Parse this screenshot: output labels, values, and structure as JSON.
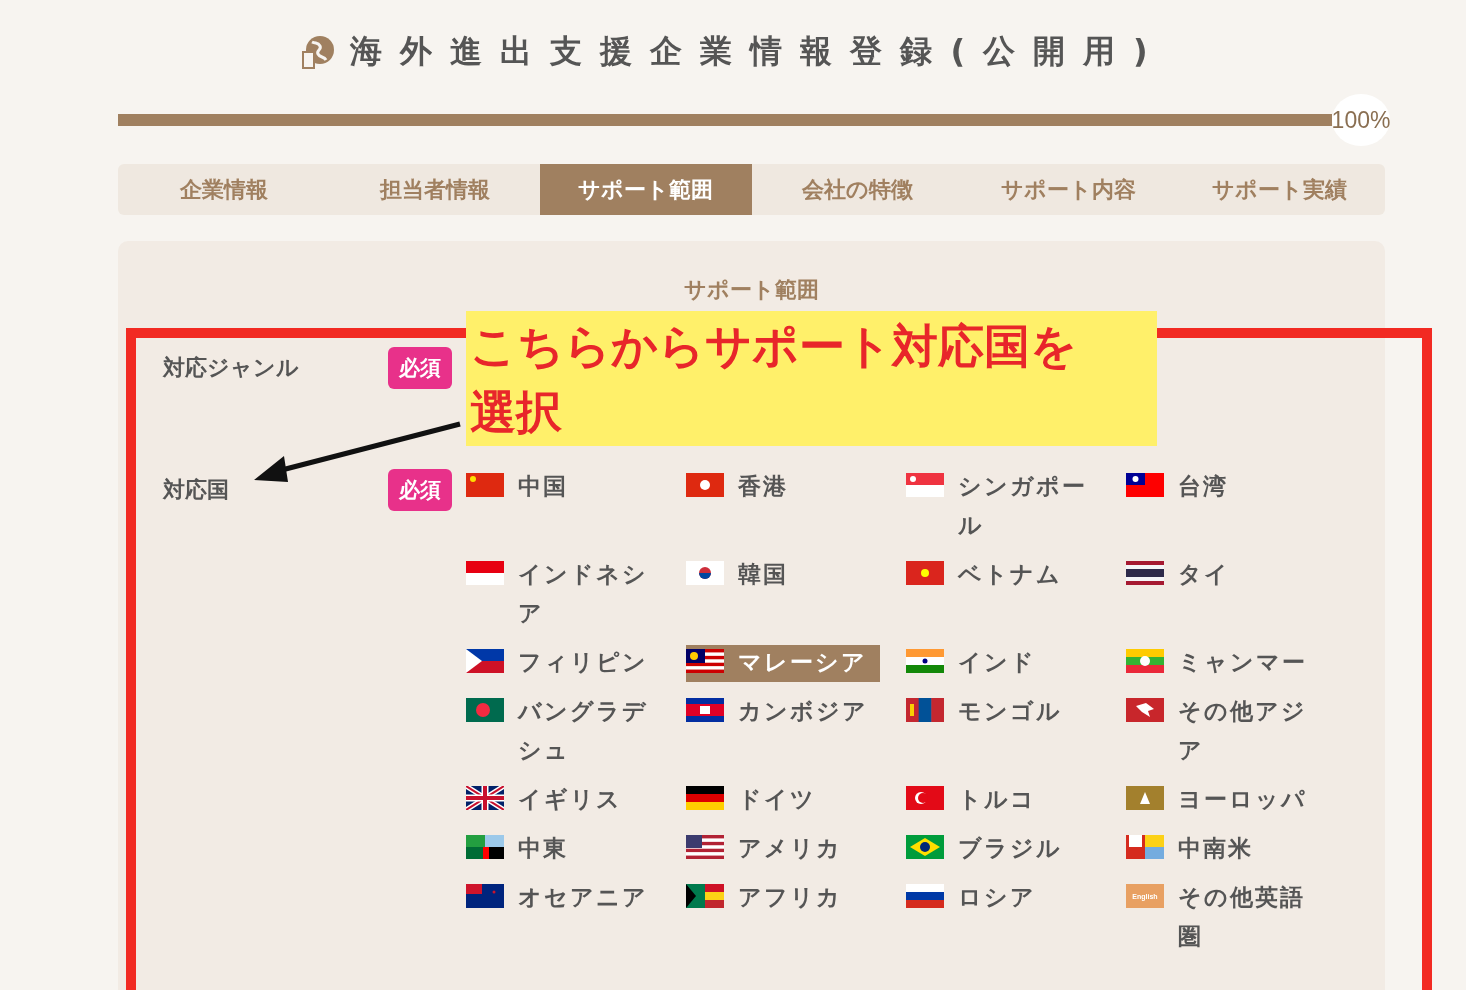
{
  "title": "海外進出支援企業情報登録(公開用)",
  "progress": {
    "level": 1,
    "reading": "100%"
  },
  "tabs": [
    {
      "label": "企業情報",
      "selected": false
    },
    {
      "label": "担当者情報",
      "selected": false
    },
    {
      "label": "サポート範囲",
      "selected": true
    },
    {
      "label": "会社の特徴",
      "selected": false
    },
    {
      "label": "サポート内容",
      "selected": false
    },
    {
      "label": "サポート実績",
      "selected": false
    }
  ],
  "section_title": "サポート範囲",
  "fields": [
    {
      "label": "対応ジャンル",
      "badge": "必須"
    },
    {
      "label": "対応国",
      "badge": "必須"
    }
  ],
  "countries": [
    {
      "label": "中国",
      "kind": "cn",
      "selected": false
    },
    {
      "label": "香港",
      "kind": "hk",
      "selected": false
    },
    {
      "label": "シンガポール",
      "kind": "sg",
      "selected": false
    },
    {
      "label": "台湾",
      "kind": "tw",
      "selected": false
    },
    {
      "label": "インドネシア",
      "kind": "id",
      "selected": false
    },
    {
      "label": "韓国",
      "kind": "kr",
      "selected": false
    },
    {
      "label": "ベトナム",
      "kind": "vn",
      "selected": false
    },
    {
      "label": "タイ",
      "kind": "th",
      "selected": false
    },
    {
      "label": "フィリピン",
      "kind": "ph",
      "selected": false
    },
    {
      "label": "マレーシア",
      "kind": "my",
      "selected": true
    },
    {
      "label": "インド",
      "kind": "in",
      "selected": false
    },
    {
      "label": "ミャンマー",
      "kind": "mm",
      "selected": false
    },
    {
      "label": "バングラデシュ",
      "kind": "bd",
      "selected": false
    },
    {
      "label": "カンボジア",
      "kind": "kh",
      "selected": false
    },
    {
      "label": "モンゴル",
      "kind": "mn",
      "selected": false
    },
    {
      "label": "その他アジア",
      "kind": "asia",
      "selected": false
    },
    {
      "label": "イギリス",
      "kind": "gb",
      "selected": false
    },
    {
      "label": "ドイツ",
      "kind": "de",
      "selected": false
    },
    {
      "label": "トルコ",
      "kind": "tr",
      "selected": false
    },
    {
      "label": "ヨーロッパ",
      "kind": "eu",
      "selected": false
    },
    {
      "label": "中東",
      "kind": "me",
      "selected": false
    },
    {
      "label": "アメリカ",
      "kind": "us",
      "selected": false
    },
    {
      "label": "ブラジル",
      "kind": "br",
      "selected": false
    },
    {
      "label": "中南米",
      "kind": "latam",
      "selected": false
    },
    {
      "label": "オセアニア",
      "kind": "oc",
      "selected": false
    },
    {
      "label": "アフリカ",
      "kind": "af",
      "selected": false
    },
    {
      "label": "ロシア",
      "kind": "ru",
      "selected": false
    },
    {
      "label": "その他英語圏",
      "kind": "en",
      "flag_text": "English",
      "selected": false
    }
  ],
  "annotation": {
    "text": "こちらからサポート対応国を選択"
  }
}
